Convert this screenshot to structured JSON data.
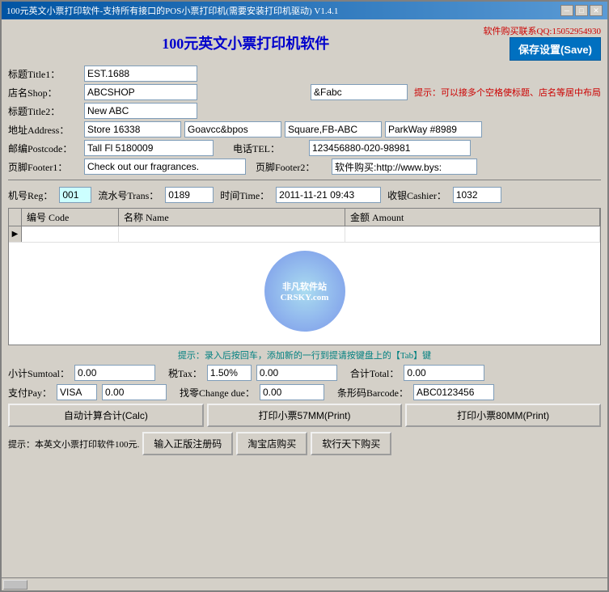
{
  "window": {
    "title": "100元英文小票打印软件-支持所有接口的POS小票打印机(需要安装打印机驱动)  V1.4.1",
    "min_btn": "─",
    "max_btn": "□",
    "close_btn": "✕"
  },
  "app": {
    "title": "100元英文小票打印机软件",
    "purchase_link": "软件购买联系QQ:15052954930",
    "save_btn": "保存设置(Save)"
  },
  "form": {
    "title1_label": "标题Title1：",
    "title1_value": "EST.1688",
    "shop_label": "店名Shop：",
    "shop_value": "ABCSHOP",
    "shop_right_value": "&Fabc",
    "hint_text": "提示：可以接多个空格使标题、店名等居中布局",
    "title2_label": "标题Title2：",
    "title2_value": "New ABC",
    "addr_label": "地址Address：",
    "addr1_value": "Store 16338",
    "addr2_value": "Goavcc&bpos",
    "addr3_value": "Square,FB-ABC",
    "addr4_value": "ParkWay #8989",
    "postcode_label": "邮编Postcode：",
    "postcode_value": "Tall Fl 5180009",
    "tel_label": "电话TEL：",
    "tel_value": "123456880-020-98981",
    "footer1_label": "页脚Footer1：",
    "footer1_value": "Check out our fragrances.",
    "footer2_label": "页脚Footer2：",
    "footer2_value": "软件购买:http://www.bys:"
  },
  "register": {
    "reg_label": "机号Reg：",
    "reg_value": "001",
    "trans_label": "流水号Trans：",
    "trans_value": "0189",
    "time_label": "时间Time：",
    "time_value": "2011-11-21 09:43",
    "cashier_label": "收银Cashier：",
    "cashier_value": "1032"
  },
  "table": {
    "col_code": "编号 Code",
    "col_name": "名称 Name",
    "col_amount": "金额 Amount",
    "rows": []
  },
  "watermark": {
    "line1": "非凡软件站",
    "line2": "CRSKY.com"
  },
  "hint_bottom": "提示：录入后按回车，添加新的一行到提请按键盘上的【Tab】键",
  "calc": {
    "subtotal_label": "小计Sumtoal：",
    "subtotal_value": "0.00",
    "tax_label": "税Tax：",
    "tax_pct": "1.50%",
    "tax_value": "0.00",
    "total_label": "合计Total：",
    "total_value": "0.00",
    "pay_label": "支付Pay：",
    "pay_method": "VISA",
    "pay_value": "0.00",
    "change_label": "找零Change due：",
    "change_value": "0.00",
    "barcode_label": "条形码Barcode：",
    "barcode_value": "ABC0123456"
  },
  "buttons": {
    "calc_btn": "自动计算合计(Calc)",
    "print57_btn": "打印小票57MM(Print)",
    "print80_btn": "打印小票80MM(Print)"
  },
  "bottom": {
    "hint": "提示：本英文小票打印软件100元.",
    "register_btn": "输入正版注册码",
    "taobao_btn": "淘宝店购买",
    "ruanxing_btn": "软行天下购买"
  }
}
